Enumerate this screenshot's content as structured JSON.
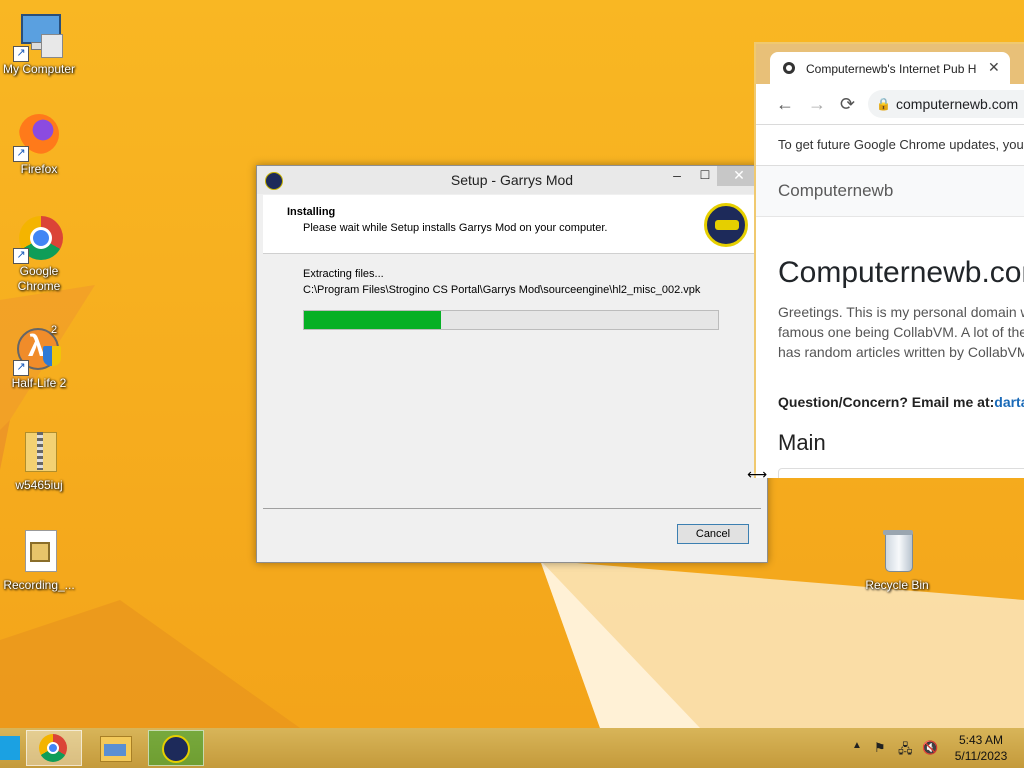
{
  "desktop": {
    "icons": [
      {
        "label": "My Computer"
      },
      {
        "label": "Firefox"
      },
      {
        "label": "Google Chrome"
      },
      {
        "label": "Half-Life 2",
        "badge": "2"
      },
      {
        "label": "w5465iuj"
      },
      {
        "label": "Recording_..."
      },
      {
        "label": "Recycle Bin"
      }
    ]
  },
  "setup": {
    "title": "Setup - Garrys Mod",
    "minimize": "–",
    "maximize": "☐",
    "close": "✕",
    "heading": "Installing",
    "subheading": "Please wait while Setup installs Garrys Mod on your computer.",
    "status": "Extracting files...",
    "path": "C:\\Program Files\\Strogino CS Portal\\Garrys Mod\\sourceengine\\hl2_misc_002.vpk",
    "progress": 0.33,
    "cancel_label": "Cancel"
  },
  "chrome": {
    "tab_title": "Computernewb's Internet Pub H",
    "tab_close": "✕",
    "url": "computernewb.com",
    "infobar": "To get future Google Chrome updates, you",
    "brand": "Computernewb",
    "site_title": "Computernewb.com",
    "para_lines": [
      "Greetings. This is my personal domain w",
      "famous one being CollabVM. A lot of the",
      "has random articles written by CollabVM"
    ],
    "question": "Question/Concern? Email me at:",
    "email": "darta",
    "section": "Main"
  },
  "taskbar": {
    "time": "5:43 AM",
    "date": "5/11/2023"
  },
  "colors": {
    "desktop": "#f7b420",
    "progress": "#06b025",
    "taskbar": "#c8a045"
  }
}
